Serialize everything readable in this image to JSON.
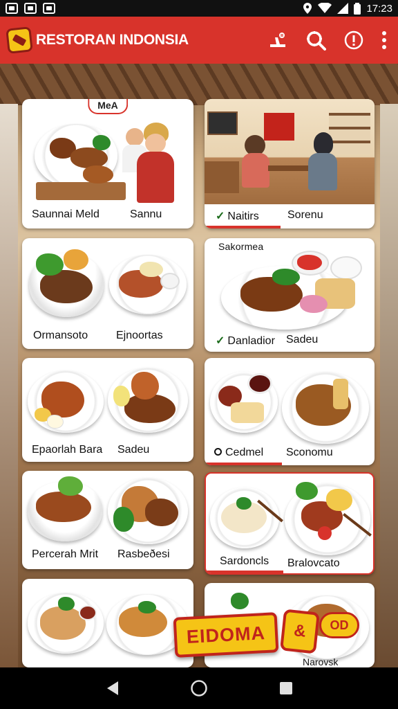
{
  "status_bar": {
    "time": "17:23"
  },
  "app_bar": {
    "title": "RESTORAN INDONSIA",
    "actions": [
      "cart-icon",
      "search-icon",
      "info-icon",
      "more-vert-icon"
    ]
  },
  "cards": {
    "c1": {
      "badge": "MeA",
      "left": "Saunnai Meld",
      "right": "Sannu"
    },
    "c2": {
      "left": "Naitirs",
      "right": "Sorenu"
    },
    "c3": {
      "left": "Ormansoto",
      "right": "Ejnoortas"
    },
    "c4": {
      "header": "Sakormea",
      "left": "Danladior",
      "right": "Sadeu"
    },
    "c5": {
      "left": "Epaorlah Bara",
      "right": "Sadeu"
    },
    "c6": {
      "left": "Cedmel",
      "right": "Sconomu"
    },
    "c7": {
      "left": "Percerah Mrit",
      "right": "Rasbeðesi"
    },
    "c8": {
      "left": "Sardoncls",
      "right": "Bralovcato"
    },
    "c9": {
      "left": "",
      "right": ""
    },
    "c10": {
      "right": "Narovsk"
    }
  },
  "promo": {
    "text": "EIDOMA",
    "badge": "&",
    "badge2": "OD"
  },
  "colors": {
    "primary": "#d8332b",
    "accent": "#f5c416",
    "check": "#1b6b1b"
  },
  "nav": [
    "back-icon",
    "home-icon",
    "recents-icon"
  ]
}
